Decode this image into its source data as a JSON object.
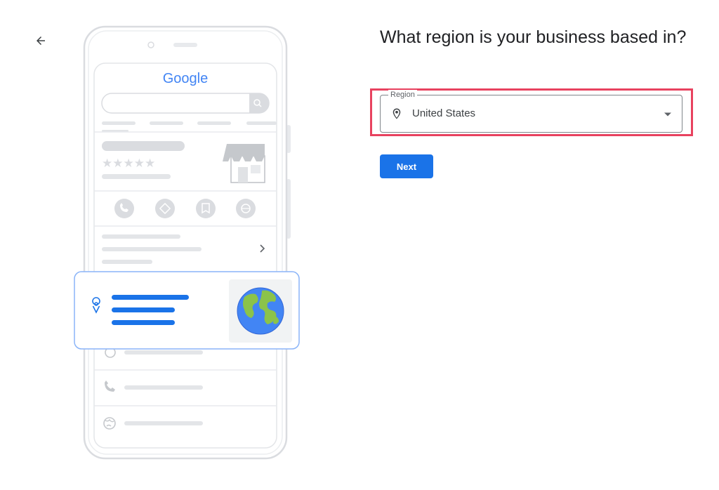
{
  "page": {
    "title": "What region is your business based in?"
  },
  "illustration": {
    "logo_text": "Google"
  },
  "region_field": {
    "label": "Region",
    "value": "United States"
  },
  "actions": {
    "next_label": "Next"
  },
  "colors": {
    "primary_blue": "#1a73e8",
    "highlight_red": "#e8425f",
    "globe_ocean": "#4285f4",
    "globe_land": "#8bc34a"
  }
}
